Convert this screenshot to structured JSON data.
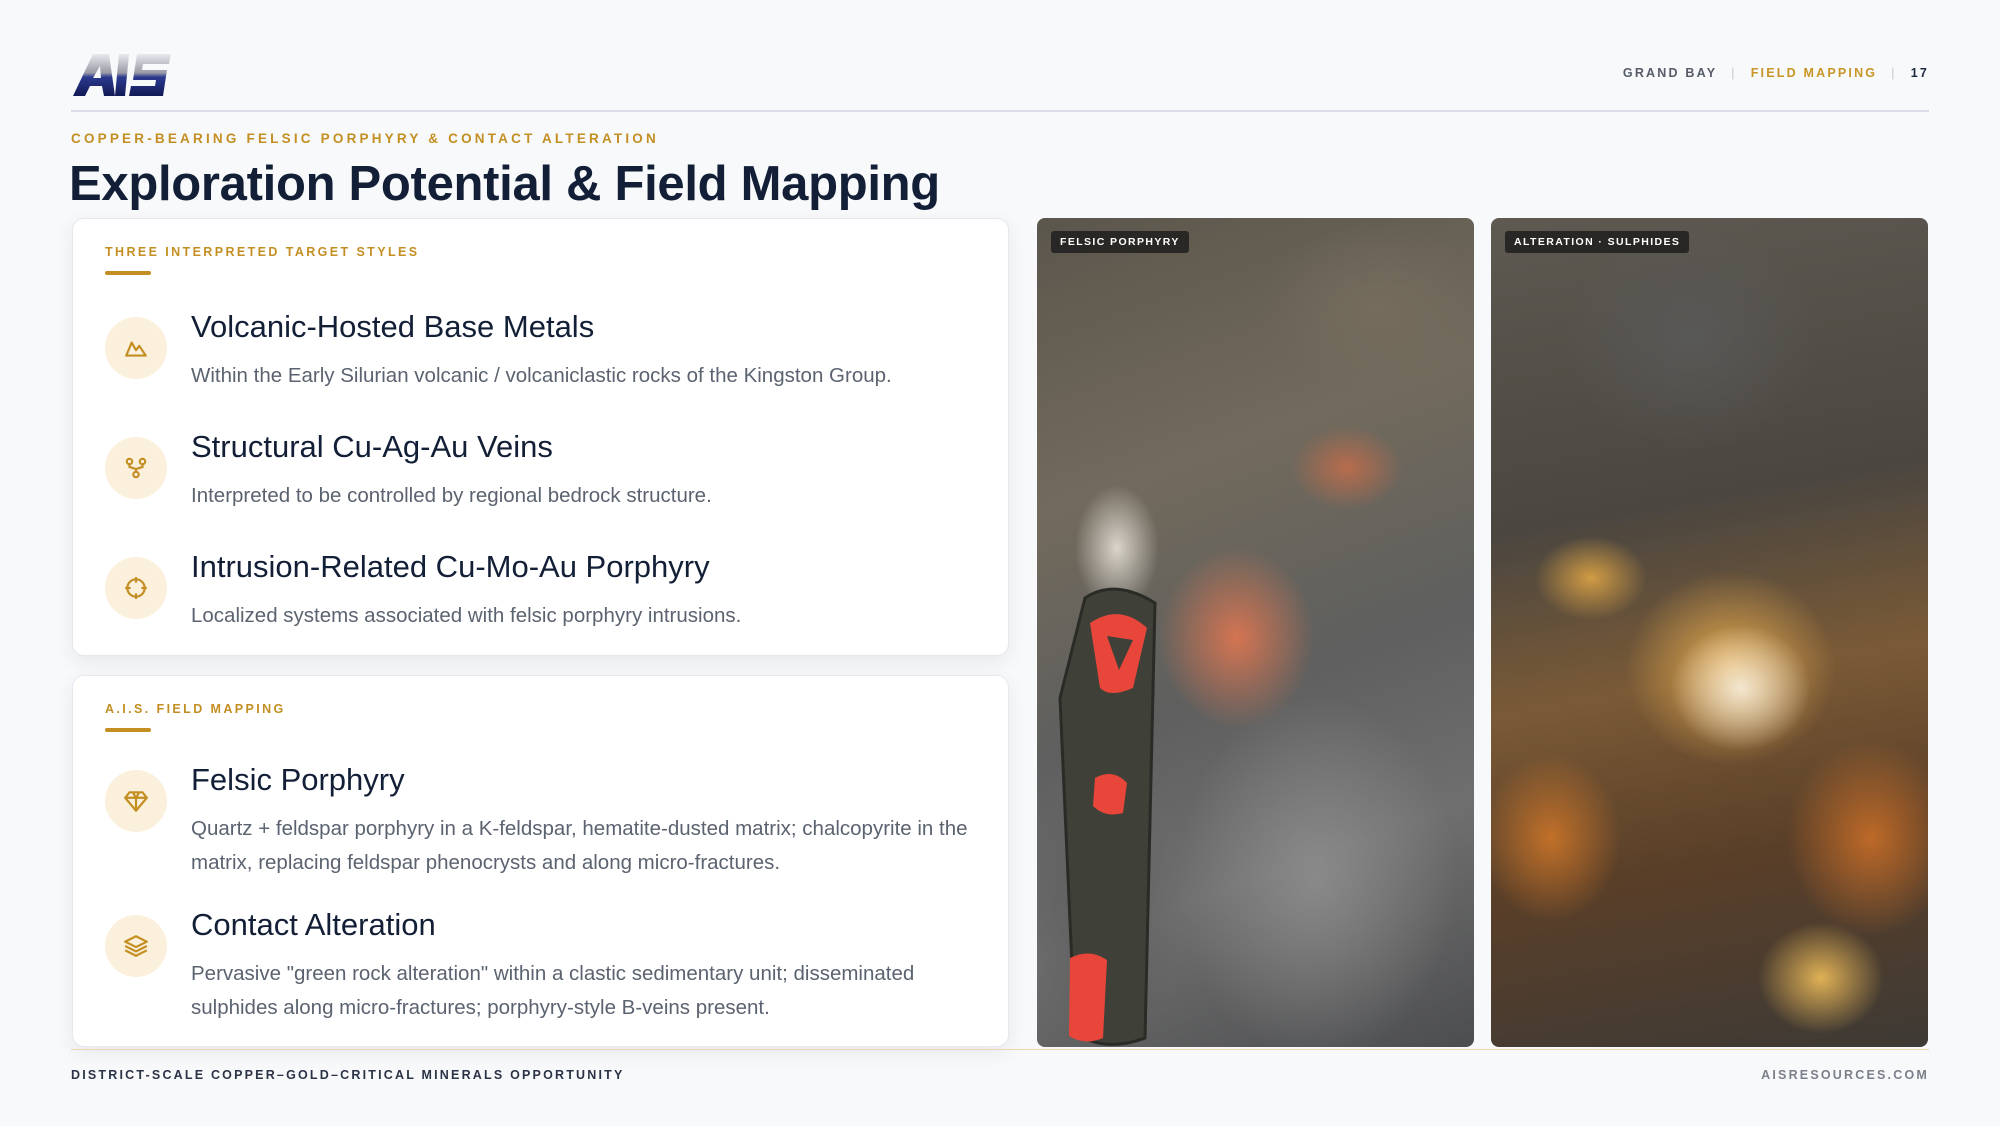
{
  "header": {
    "logo_text": "AIS",
    "nav": {
      "location": "GRAND BAY",
      "section": "FIELD MAPPING",
      "page_number": "17"
    }
  },
  "eyebrow": "COPPER-BEARING FELSIC PORPHYRY & CONTACT ALTERATION",
  "title": "Exploration Potential & Field Mapping",
  "targets": {
    "label": "THREE INTERPRETED TARGET STYLES",
    "items": [
      {
        "icon": "mountain-icon",
        "title": "Volcanic-Hosted Base Metals",
        "desc": "Within the Early Silurian volcanic / volcaniclastic rocks of the Kingston Group."
      },
      {
        "icon": "network-icon",
        "title": "Structural Cu-Ag-Au Veins",
        "desc": "Interpreted to be controlled by regional bedrock structure."
      },
      {
        "icon": "crosshair-icon",
        "title": "Intrusion-Related Cu-Mo-Au Porphyry",
        "desc": "Localized systems associated with felsic porphyry intrusions."
      }
    ]
  },
  "mapping": {
    "label": "A.I.S. FIELD MAPPING",
    "items": [
      {
        "icon": "gem-icon",
        "title": "Felsic Porphyry",
        "desc": "Quartz + feldspar porphyry in a K-feldspar, hematite-dusted matrix; chalcopyrite in the matrix, replacing feldspar phenocrysts and along micro-fractures."
      },
      {
        "icon": "layers-icon",
        "title": "Contact Alteration",
        "desc": "Pervasive \"green rock alteration\" within a clastic sedimentary unit; disseminated sulphides along micro-fractures; porphyry-style B-veins present."
      }
    ]
  },
  "photos": [
    {
      "tag": "FELSIC PORPHYRY"
    },
    {
      "tag": "ALTERATION · SULPHIDES"
    }
  ],
  "footer": {
    "left": "DISTRICT-SCALE COPPER–GOLD–CRITICAL MINERALS OPPORTUNITY",
    "right": "AISRESOURCES.COM"
  },
  "colors": {
    "accent": "#c48f22",
    "navy": "#131f36",
    "icon_bg": "#fbf0dc"
  }
}
